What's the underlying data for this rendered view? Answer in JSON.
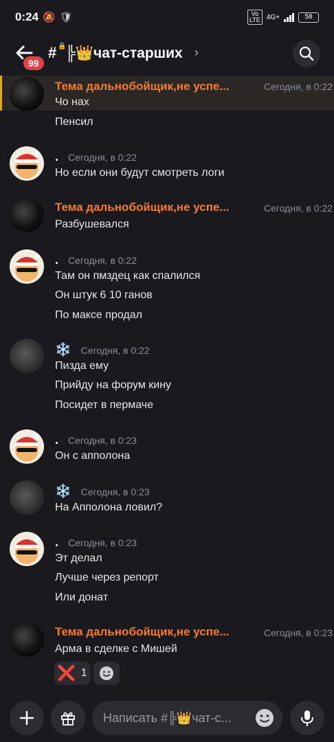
{
  "status_bar": {
    "time": "0:24",
    "net_top": "Vo",
    "net_bottom": "LTE",
    "network": "4G+",
    "battery": "58"
  },
  "header": {
    "back_badge": "99",
    "channel_name": "╠👑чат-старших"
  },
  "messages": [
    {
      "author": "Тема дальнобойщик,не успе...",
      "timestamp": "Сегодня, в 0:22",
      "lines": [
        "Чо нах",
        "Пенсил"
      ]
    },
    {
      "author": ".",
      "timestamp": "Сегодня, в 0:22",
      "lines": [
        "Но если они будут смотреть логи"
      ]
    },
    {
      "author": "Тема дальнобойщик,не успе...",
      "timestamp": "Сегодня, в 0:22",
      "lines": [
        "Разбушевался"
      ]
    },
    {
      "author": ".",
      "timestamp": "Сегодня, в 0:22",
      "lines": [
        "Там он пмздец как спалился",
        "Он штук 6 10 ганов",
        "По максе продал"
      ]
    },
    {
      "author": "❄️",
      "timestamp": "Сегодня, в 0:22",
      "lines": [
        "Пизда ему",
        "Прийду на форум кину",
        "Посидет в пермаче"
      ]
    },
    {
      "author": ".",
      "timestamp": "Сегодня, в 0:23",
      "lines": [
        "Он с апполона"
      ]
    },
    {
      "author": "❄️",
      "timestamp": "Сегодня, в 0:23",
      "lines": [
        "На Апполона ловил?"
      ]
    },
    {
      "author": ".",
      "timestamp": "Сегодня, в 0:23",
      "lines": [
        "Эт делал",
        "Лучше через репорт",
        "Или донат"
      ]
    },
    {
      "author": "Тема дальнобойщик,не успе...",
      "timestamp": "Сегодня, в 0:23",
      "lines": [
        "Арма в сделке с Мишей"
      ]
    }
  ],
  "reactions": [
    {
      "emoji": "❌",
      "count": "1"
    }
  ],
  "composer": {
    "placeholder": "Написать #╠👑чат-с..."
  },
  "colors": {
    "background": "#1a1a1e",
    "username_orange": "#f47b2a",
    "highlight_bar": "#e6a817",
    "badge_red": "#e63f45",
    "surface": "#2b2b31"
  }
}
